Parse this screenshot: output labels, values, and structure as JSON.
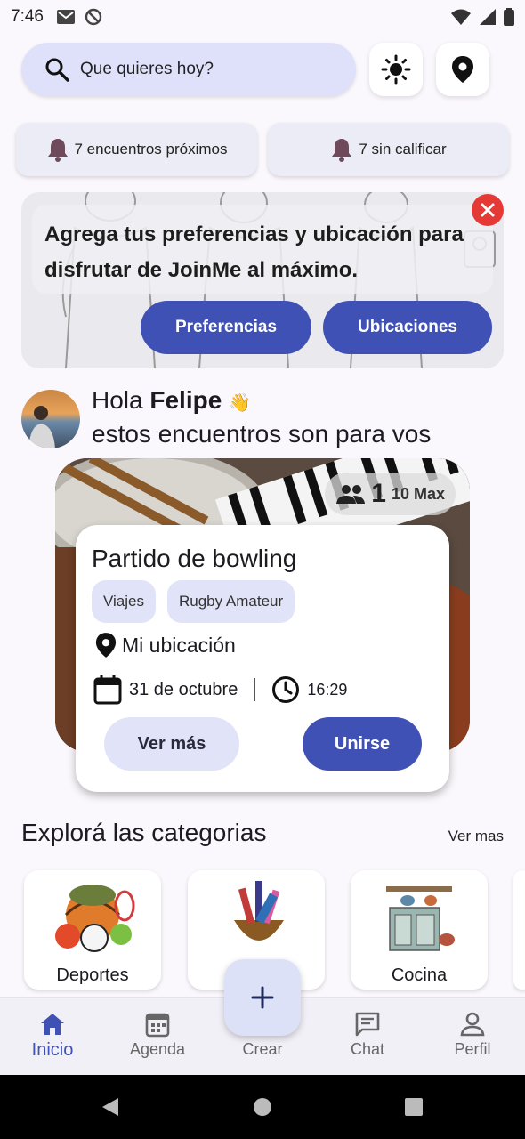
{
  "status_bar": {
    "time": "7:46"
  },
  "search": {
    "label": "Que quieres hoy?"
  },
  "stats": {
    "upcoming": "7 encuentros próximos",
    "unrated": "7 sin calificar"
  },
  "banner": {
    "message": "Agrega tus preferencias y ubicación para disfrutar de JoinMe al máximo.",
    "preferences_label": "Preferencias",
    "locations_label": "Ubicaciones"
  },
  "greeting": {
    "hello": "Hola",
    "name": "Felipe",
    "emoji": "👋",
    "subtitle": "estos encuentros son para vos"
  },
  "event": {
    "participants": "1",
    "max": "10 Max",
    "title": "Partido de bowling",
    "tags": [
      "Viajes",
      "Rugby Amateur"
    ],
    "location": "Mi ubicación",
    "date": "31 de octubre",
    "time": "16:29",
    "more_label": "Ver más",
    "join_label": "Unirse"
  },
  "categories": {
    "title": "Explorá las categorias",
    "more_label": "Ver mas",
    "items": [
      {
        "label": "Deportes"
      },
      {
        "label": ""
      },
      {
        "label": "Cocina"
      }
    ]
  },
  "nav": {
    "items": [
      {
        "label": "Inicio",
        "icon": "home-icon"
      },
      {
        "label": "Agenda",
        "icon": "calendar-icon"
      },
      {
        "label": "Crear",
        "icon": "plus-icon"
      },
      {
        "label": "Chat",
        "icon": "chat-icon"
      },
      {
        "label": "Perfil",
        "icon": "person-icon"
      }
    ]
  },
  "colors": {
    "primary": "#3f51b5",
    "chip": "#e1e3f8",
    "search": "#dfe0fa",
    "close": "#e53935"
  }
}
